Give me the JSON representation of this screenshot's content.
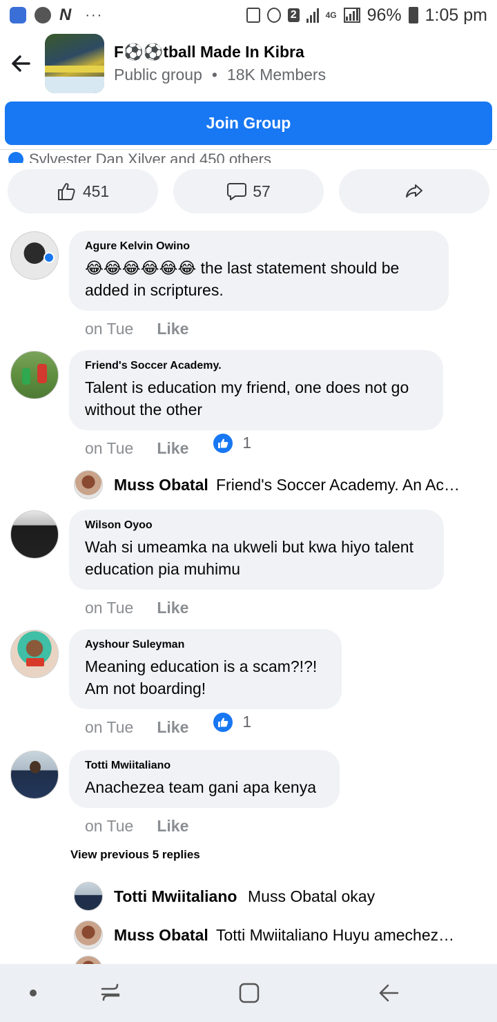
{
  "status_bar": {
    "left_icons": [
      "screenshot-icon",
      "chrome-icon",
      "n-app-icon",
      "more-dots-icon"
    ],
    "n_label": "N",
    "more_dots": "···",
    "sim_badge": "2",
    "network": "4G",
    "battery": "96%",
    "time": "1:05 pm"
  },
  "group": {
    "title": "F⚽⚽tball Made In Kibra",
    "visibility": "Public group",
    "separator": "•",
    "members": "18K Members",
    "join_label": "Join Group"
  },
  "post": {
    "reactors_text": "Sylvester Dan Xilver and 450 others",
    "like_count": "451",
    "comment_count": "57"
  },
  "comments": [
    {
      "author": "Agure Kelvin Owino",
      "text": "😂😂😂😂😂😂 the last statement should be added in scriptures.",
      "time": "on Tue",
      "like_label": "Like",
      "reactions": null
    },
    {
      "author": "Friend's Soccer Academy.",
      "text": "Talent is education my friend, one does not go without the other",
      "time": "on Tue",
      "like_label": "Like",
      "reactions": "1"
    },
    {
      "author": "Wilson Oyoo",
      "text": "Wah si umeamka na ukweli but kwa hiyo talent education pia muhimu",
      "time": "on Tue",
      "like_label": "Like",
      "reactions": null
    },
    {
      "author": "Ayshour Suleyman",
      "text": "Meaning education is a scam?!?! Am not boarding!",
      "time": "on Tue",
      "like_label": "Like",
      "reactions": "1"
    },
    {
      "author": "Totti Mwiitaliano",
      "text": "Anachezea team gani apa kenya",
      "time": "on Tue",
      "like_label": "Like",
      "reactions": null
    }
  ],
  "replies": [
    {
      "author": "Muss Obatal",
      "text": "Friend's Soccer Academy. An Ac…"
    },
    {
      "author": "Totti Mwiitaliano",
      "text": "Muss Obatal okay"
    },
    {
      "author": "Muss Obatal",
      "text": "Totti Mwiitaliano Huyu amechez…"
    }
  ],
  "view_previous": "View previous 5 replies",
  "colors": {
    "accent": "#1877f2",
    "bubble": "#f0f2f5",
    "muted": "#65676b"
  }
}
